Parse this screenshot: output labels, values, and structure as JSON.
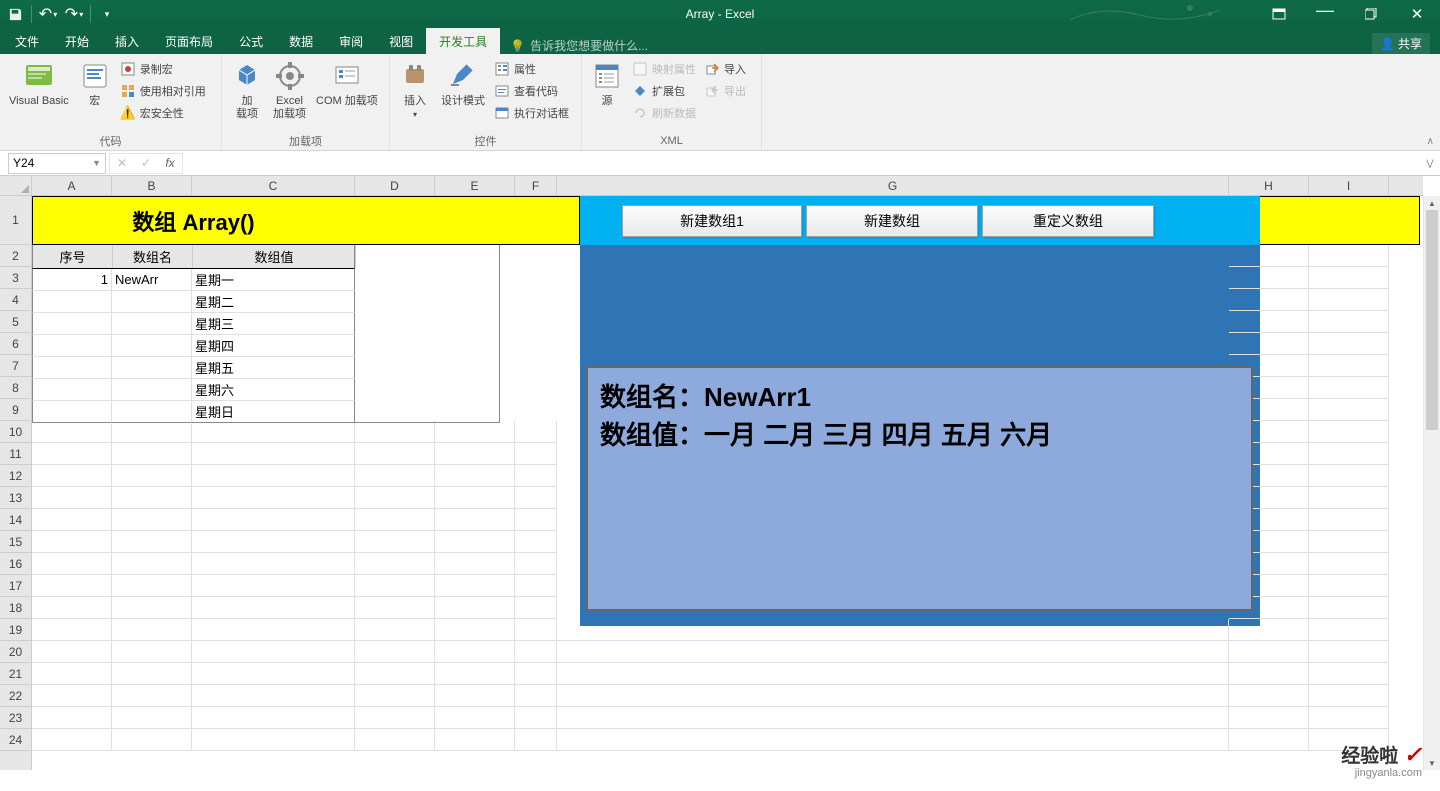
{
  "app": {
    "title": "Array - Excel"
  },
  "qat": {
    "save": "💾",
    "undo": "↶",
    "redo": "↷",
    "customize": "▾"
  },
  "win": {
    "ribbon_opts": "▭",
    "min": "—",
    "max": "❐",
    "close": "✕"
  },
  "tabs": {
    "file": "文件",
    "home": "开始",
    "insert": "插入",
    "page_layout": "页面布局",
    "formulas": "公式",
    "data": "数据",
    "review": "审阅",
    "view": "视图",
    "developer": "开发工具",
    "tell_me": "告诉我您想要做什么...",
    "share": "共享"
  },
  "ribbon": {
    "code": {
      "vb": "Visual Basic",
      "macros": "宏",
      "record": "录制宏",
      "relative": "使用相对引用",
      "security": "宏安全性",
      "label": "代码"
    },
    "addins": {
      "addins": "加\n载项",
      "excel": "Excel\n加载项",
      "com": "COM 加载项",
      "label": "加载项"
    },
    "controls": {
      "insert": "插入",
      "design": "设计模式",
      "properties": "属性",
      "view_code": "查看代码",
      "run_dialog": "执行对话框",
      "label": "控件"
    },
    "xml": {
      "source": "源",
      "map_props": "映射属性",
      "expansion": "扩展包",
      "refresh": "刷新数据",
      "import": "导入",
      "export": "导出",
      "label": "XML"
    }
  },
  "name_box": "Y24",
  "formula": "",
  "cols": {
    "A": "A",
    "B": "B",
    "C": "C",
    "D": "D",
    "E": "E",
    "F": "F",
    "G": "G",
    "H": "H",
    "I": "I"
  },
  "col_widths": {
    "A": 80,
    "B": 80,
    "C": 163,
    "D": 80,
    "E": 80,
    "F": 80,
    "G": 672,
    "H": 80,
    "I": 80
  },
  "row_heights": {
    "r1": 49,
    "rn": 22
  },
  "rows": [
    "1",
    "2",
    "3",
    "4",
    "5",
    "6",
    "7",
    "8",
    "9",
    "10",
    "11",
    "12",
    "13",
    "14",
    "15",
    "16",
    "17",
    "18",
    "19",
    "20",
    "21",
    "22",
    "23",
    "24"
  ],
  "sheet": {
    "title": "数组 Array()",
    "headers": {
      "seq": "序号",
      "name": "数组名",
      "val": "数组值"
    },
    "data_seq": "1",
    "data_name": "NewArr",
    "vals": [
      "星期一",
      "星期二",
      "星期三",
      "星期四",
      "星期五",
      "星期六",
      "星期日"
    ],
    "btn1": "新建数组1",
    "btn2": "新建数组",
    "btn3": "重定义数组",
    "overlay_line1": "数组名：NewArr1",
    "overlay_line2": "数组值：一月 二月 三月 四月 五月 六月"
  },
  "watermark": {
    "line1": "经验啦",
    "check": "✓",
    "line2": "jingyanla.com"
  }
}
